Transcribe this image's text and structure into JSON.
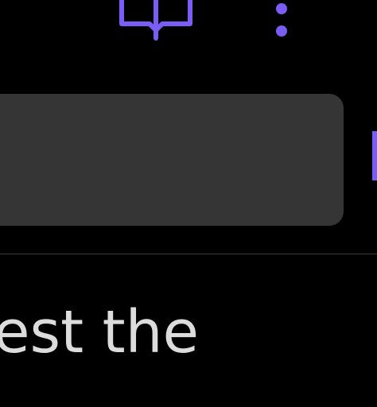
{
  "header": {
    "icons": [
      {
        "name": "book-icon",
        "color": "#7b5cf5"
      },
      {
        "name": "more-vertical-icon",
        "color": "#7b5cf5"
      }
    ]
  },
  "search": {
    "background": "#353535",
    "value": ""
  },
  "content": {
    "text": "est the"
  },
  "colors": {
    "accent": "#7b5cf5",
    "background": "#000000",
    "text": "#dcdcdc",
    "divider": "#3a3a3a"
  }
}
